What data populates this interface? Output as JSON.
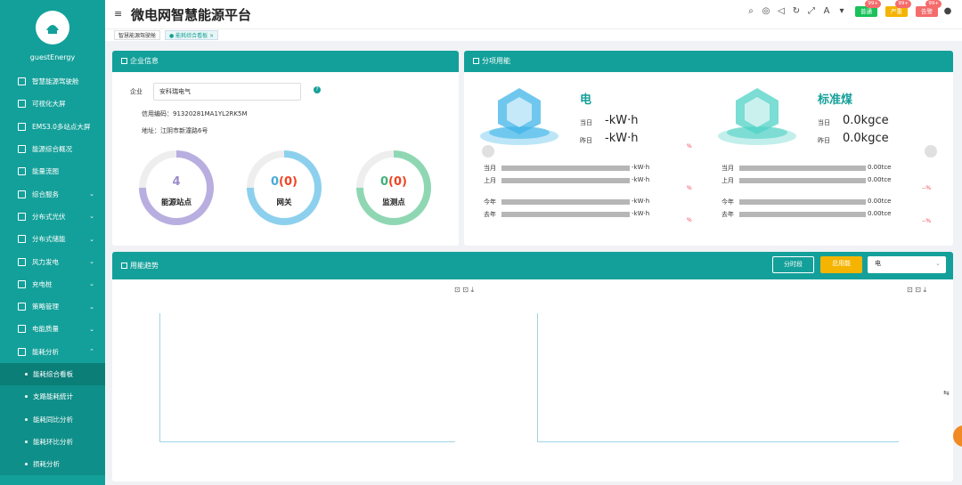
{
  "user": {
    "name": "guestEnergy"
  },
  "sidebar": {
    "items": [
      {
        "label": "智慧能源驾驶舱"
      },
      {
        "label": "可视化大屏"
      },
      {
        "label": "EMS3.0多站点大屏"
      },
      {
        "label": "能源综合概况"
      },
      {
        "label": "能量流图"
      },
      {
        "label": "综合服务"
      },
      {
        "label": "分布式光伏"
      },
      {
        "label": "分布式储能"
      },
      {
        "label": "风力发电"
      },
      {
        "label": "充电桩"
      },
      {
        "label": "策略管理"
      },
      {
        "label": "电能质量"
      },
      {
        "label": "能耗分析"
      }
    ],
    "subitems": [
      {
        "label": "能耗综合看板"
      },
      {
        "label": "支路能耗统计"
      },
      {
        "label": "能耗同比分析"
      },
      {
        "label": "能耗环比分析"
      },
      {
        "label": "损耗分析"
      }
    ]
  },
  "header": {
    "title": "微电网智慧能源平台",
    "badges": [
      {
        "label": "普通",
        "count": "99+"
      },
      {
        "label": "严重",
        "count": "99+"
      },
      {
        "label": "告警",
        "count": "99+"
      }
    ]
  },
  "tabs": [
    {
      "label": "智慧能源驾驶舱"
    },
    {
      "label": "能耗综合看板",
      "close": "×"
    }
  ],
  "company": {
    "title": "企业信息",
    "company_label": "企业",
    "company_value": "安科瑞电气",
    "credit_label": "信用编码：",
    "credit_value": "91320281MA1YL2RK5M",
    "address_label": "地址：",
    "address_value": "江阴市新潼路6号",
    "stats": [
      {
        "value": "4",
        "label": "能源站点",
        "color": "#9b8cc9"
      },
      {
        "value": "0(0)",
        "label": "网关",
        "color": "#4aa9d9"
      },
      {
        "value": "0(0)",
        "label": "监测点",
        "color": "#3db37a"
      }
    ],
    "stat_sep": "(",
    "stat_close": ")"
  },
  "sub_energy": {
    "title": "分项用能",
    "items": [
      {
        "name": "电",
        "today_label": "当日",
        "today_value": "-kW·h",
        "yest_label": "昨日",
        "yest_value": "-kW·h",
        "rows": [
          {
            "label": "当月",
            "value": "-kW·h"
          },
          {
            "label": "上月",
            "value": "-kW·h"
          },
          {
            "label": "今年",
            "value": "-kW·h"
          },
          {
            "label": "去年",
            "value": "-kW·h"
          }
        ],
        "pcts": [
          "%",
          "%",
          "%"
        ]
      },
      {
        "name": "标准煤",
        "today_label": "当日",
        "today_value": "0.0kgce",
        "yest_label": "昨日",
        "yest_value": "0.0kgce",
        "rows": [
          {
            "label": "当月",
            "value": "0.00tce"
          },
          {
            "label": "上月",
            "value": "0.00tce"
          },
          {
            "label": "今年",
            "value": "0.00tce"
          },
          {
            "label": "去年",
            "value": "0.00tce"
          }
        ],
        "pcts": [
          "--%",
          "--%"
        ]
      }
    ]
  },
  "trend": {
    "title": "用能趋势",
    "btn_time": "分时段",
    "btn_usage": "总用能",
    "select_value": "电"
  },
  "colors": {
    "accent": "#14a09a",
    "warn": "#f5b400"
  }
}
